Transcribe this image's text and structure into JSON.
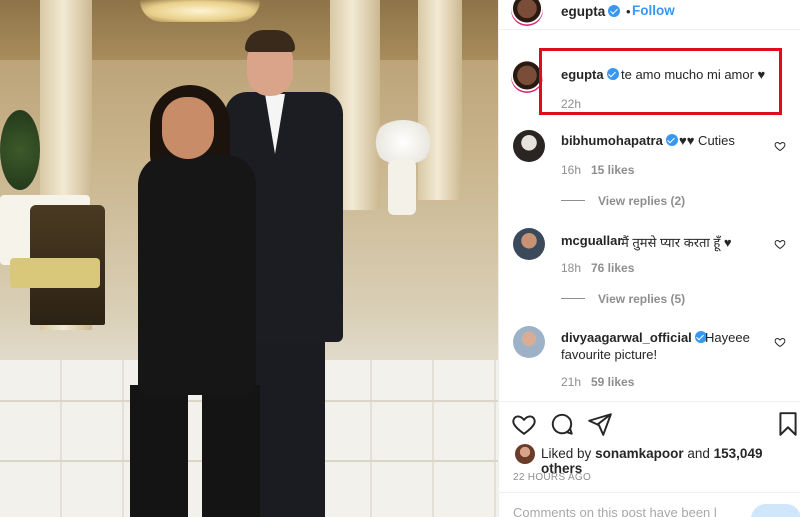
{
  "header": {
    "username": "egupta",
    "separator": "•",
    "follow_label": "Follow"
  },
  "caption": {
    "username": "egupta",
    "text": "te amo mucho mi amor ♥",
    "time": "22h"
  },
  "comments": [
    {
      "username": "bibhumohapatra",
      "text": "♥♥ Cuties",
      "time": "16h",
      "likes": "15 likes",
      "replies": "View replies (2)"
    },
    {
      "username": "mcguallar",
      "text": "मैं तुमसे प्यार करता हूँ ♥",
      "time": "18h",
      "likes": "76 likes",
      "replies": "View replies (5)"
    },
    {
      "username": "divyaagarwal_official",
      "text_line1": "Hayeee",
      "text_line2": "favourite picture!",
      "time": "21h",
      "likes": "59 likes"
    }
  ],
  "likes": {
    "prefix": "Liked by",
    "user": "sonamkapoor",
    "middle": "and",
    "others": "153,049 others"
  },
  "timestamp": "22 HOURS AGO",
  "add_comment_placeholder": "Comments on this post have been l",
  "colors": {
    "accent": "#3897f0",
    "highlight_box": "#e00d18",
    "muted": "#8e8e8e"
  },
  "icons": {
    "like": "heart-icon",
    "comment": "comment-icon",
    "share": "share-icon",
    "save": "bookmark-icon",
    "verified": "verified-badge-icon"
  }
}
